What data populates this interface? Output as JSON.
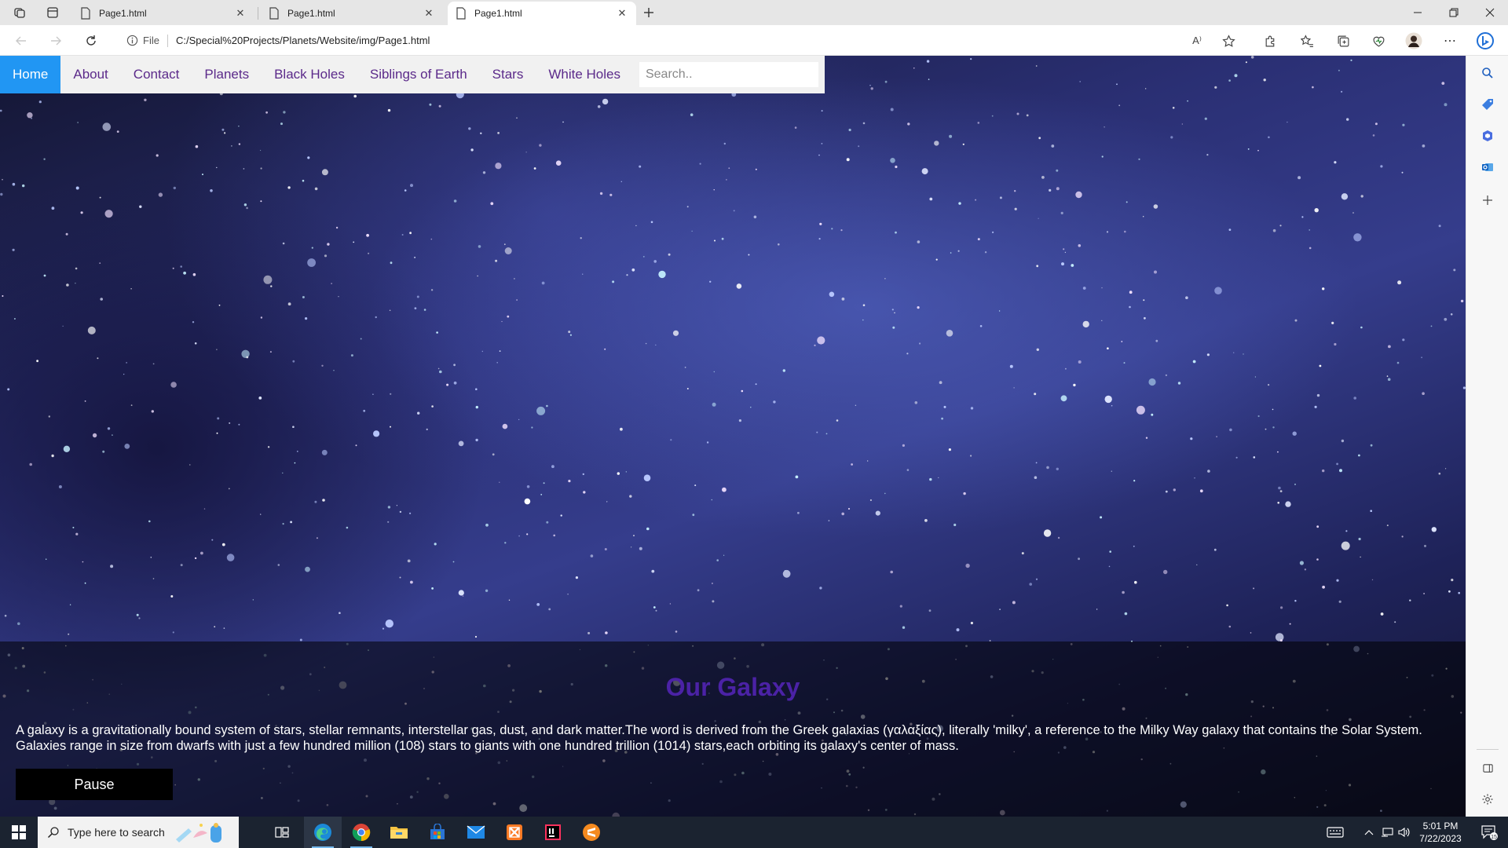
{
  "browser": {
    "tabs": [
      {
        "title": "Page1.html",
        "active": false
      },
      {
        "title": "Page1.html",
        "active": false
      },
      {
        "title": "Page1.html",
        "active": true
      }
    ],
    "address": {
      "scheme_label": "File",
      "url": "C:/Special%20Projects/Planets/Website/img/Page1.html"
    },
    "read_aloud_label": "A⁾"
  },
  "page": {
    "nav": {
      "items": [
        {
          "label": "Home",
          "active": true
        },
        {
          "label": "About"
        },
        {
          "label": "Contact"
        },
        {
          "label": "Planets"
        },
        {
          "label": "Black Holes"
        },
        {
          "label": "Siblings of Earth"
        },
        {
          "label": "Stars"
        },
        {
          "label": "White Holes"
        }
      ],
      "search_placeholder": "Search.."
    },
    "heading": "Our Galaxy",
    "body_text": "A galaxy is a gravitationally bound system of stars, stellar remnants, interstellar gas, dust, and dark matter.The word is derived from the Greek galaxias (γαλαξίας), literally 'milky', a reference to the Milky Way galaxy that contains the Solar System. Galaxies range in size from dwarfs with just a few hundred million (108) stars to giants with one hundred trillion (1014) stars,each orbiting its galaxy's center of mass.",
    "pause_label": "Pause"
  },
  "taskbar": {
    "search_placeholder": "Type here to search",
    "time": "5:01 PM",
    "date": "7/22/2023",
    "notification_count": "15"
  },
  "colors": {
    "nav_active": "#2196f3",
    "nav_link": "#5b2a8a",
    "heading": "#4b22a6",
    "taskbar": "#1b2330"
  }
}
